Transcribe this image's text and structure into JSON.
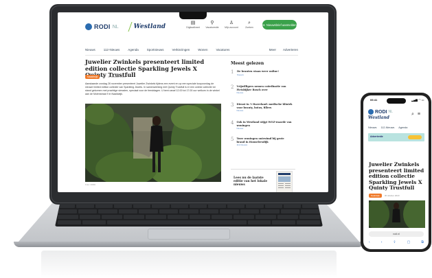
{
  "site": {
    "logo": "RODI",
    "logo_suffix": "NL",
    "region": "Westland",
    "header_icons": [
      {
        "name": "Digitaalkrant",
        "icon": "newspaper-icon"
      },
      {
        "name": "Vacaturesite",
        "icon": "pin-icon"
      },
      {
        "name": "Mijn account",
        "icon": "user-icon"
      },
      {
        "name": "Zoeken",
        "icon": "search-icon"
      }
    ],
    "subscribe": "Nieuwsbrief aanmelden",
    "nav": [
      "Nieuws",
      "112-Nieuws",
      "Agenda",
      "Sportnieuws",
      "Verkiezingen",
      "Wonen",
      "Vacatures"
    ],
    "nav_right": [
      "Meer",
      "Adverteren"
    ]
  },
  "article": {
    "headline": "Juwelier Zwinkels presenteert limited edition collectie Sparkling Jewels X Quinty Trustfull",
    "tag": "Naaldwijk",
    "date": "30 oktober 2023",
    "lead": "Aanstaande zondag 26 november presenteert Juwelier Zwinkels tijdens een event en op een speciale koopzondag de nieuwe limited edition collectie van Sparkling Jewels. In samenwerking met Quinty Trustfull is er een unieke collectie tot stand gekomen met prachtige sieraden, speciaal voor de feestdagen. U bent vanaf 12.00 tot 17.00 uur welkom in de winkel aan de Molenstraat 9 in Naaldwijk.",
    "caption": "Foto: RODI"
  },
  "sidebar": {
    "title": "Meest gelezen",
    "items": [
      {
        "num": "1",
        "text": "De kranten staan weer online!",
        "sub": "Nieuws"
      },
      {
        "num": "2",
        "text": "Vrijwilligers nemen coördinatie van Fietsbijker Bosch over",
        "sub": "Nieuws"
      },
      {
        "num": "3",
        "text": "Dienst in 't Harreland: medische kliniek voor beauty, botox, fillers",
        "sub": "Nieuws"
      },
      {
        "num": "4",
        "text": "Ook in Westland stijgt WOZ-waarde van woningen",
        "sub": "Nieuws"
      },
      {
        "num": "5",
        "text": "Twee woningen ontruimd bij grote brand in Honselersdijk",
        "sub": "112-Nieuws"
      }
    ],
    "promo": "Lees nu de laatste editie van het lokale nieuws"
  },
  "phone": {
    "time": "09:41",
    "status": "▂▄▆ ◠ ▭",
    "nav": [
      "Nieuws",
      "112-Nieuws",
      "Agenda"
    ],
    "ad_text": "Advertentie",
    "headline": "Juwelier Zwinkels presenteert limited edition collectie Sparkling Jewels X Quinty Trustfull",
    "tag": "Naaldwijk",
    "date": "30 oktober 2023",
    "url": "rodi.nl",
    "bottom": [
      "‹",
      "›",
      "⇪",
      "▢",
      "⧉"
    ]
  },
  "colors": {
    "brand": "#1f3c6b",
    "accent": "#3aa14a",
    "tag": "#f07a2a",
    "slash": "#7fbf3f"
  }
}
